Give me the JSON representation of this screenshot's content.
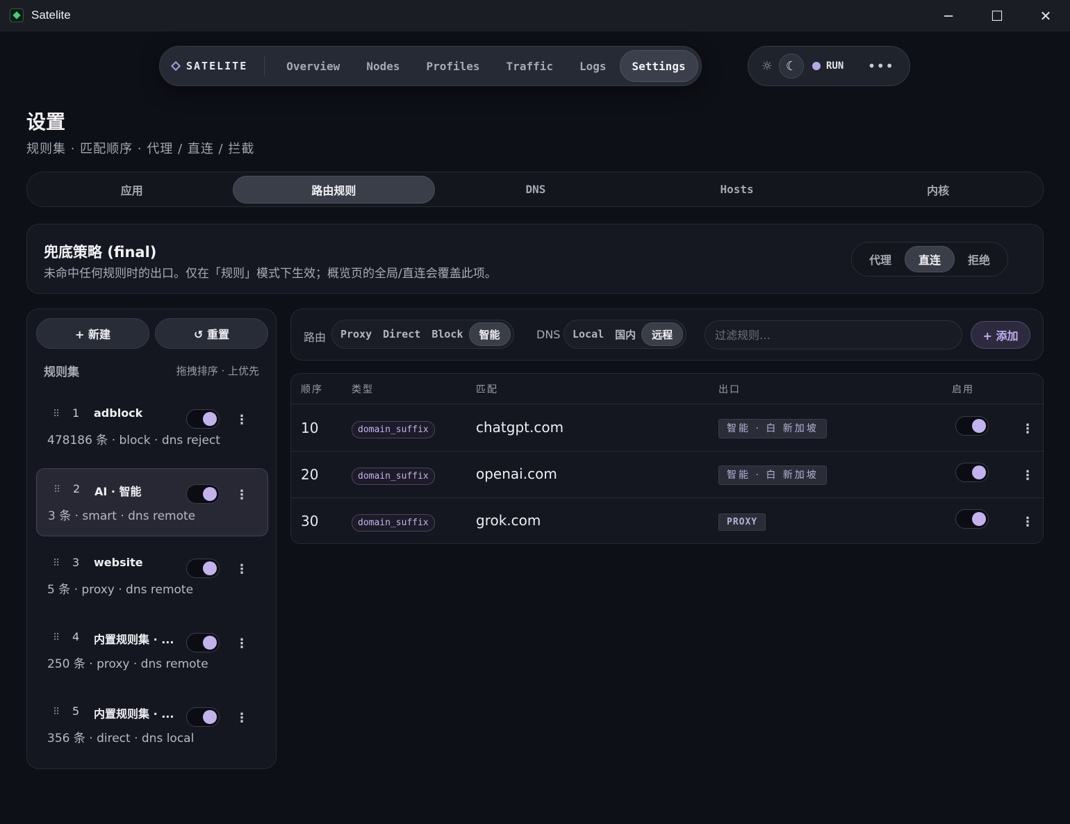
{
  "window": {
    "title": "Satelite",
    "minimize": "─",
    "maximize": "☐",
    "close": "✕"
  },
  "topnav": {
    "brand": "SATELITE",
    "items": [
      "Overview",
      "Nodes",
      "Profiles",
      "Traffic",
      "Logs",
      "Settings"
    ],
    "active": "Settings",
    "sun_icon": "☼",
    "moon_icon": "☾",
    "status": "RUN",
    "more": "•••"
  },
  "page": {
    "title": "设置",
    "subtitle": "规则集 · 匹配顺序 · 代理 / 直连 / 拦截"
  },
  "tabs": [
    "应用",
    "路由规则",
    "DNS",
    "Hosts",
    "内核"
  ],
  "final": {
    "title": "兜底策略 (final)",
    "desc": "未命中任何规则时的出口。仅在「规则」模式下生效；概览页的全局/直连会覆盖此项。",
    "options": [
      "代理",
      "直连",
      "拒绝"
    ],
    "selected": "直连"
  },
  "left": {
    "new_label": "+ 新建",
    "reset_label": "↺ 重置",
    "heading": "规则集",
    "hint": "拖拽排序 · 上优先",
    "grip": "⠿",
    "kebab": "⋮",
    "rulesets": [
      {
        "idx": "1",
        "name": "adblock",
        "meta": "478186 条 · block · dns reject",
        "enabled": true
      },
      {
        "idx": "2",
        "name": "AI · 智能",
        "meta": "3 条 · smart · dns remote",
        "enabled": true
      },
      {
        "idx": "3",
        "name": "website",
        "meta": "5 条 · proxy · dns remote",
        "enabled": true
      },
      {
        "idx": "4",
        "name": "内置规则集 · ...",
        "meta": "250 条 · proxy · dns remote",
        "enabled": true
      },
      {
        "idx": "5",
        "name": "内置规则集 · ...",
        "meta": "356 条 · direct · dns local",
        "enabled": true
      }
    ]
  },
  "filter": {
    "route_label": "路由",
    "route_options": [
      "Proxy",
      "Direct",
      "Block",
      "智能"
    ],
    "route_selected": "智能",
    "dns_label": "DNS",
    "dns_options": [
      "Local",
      "国内",
      "远程"
    ],
    "dns_selected": "远程",
    "search_placeholder": "过滤规则…",
    "add_label": "+ 添加"
  },
  "table": {
    "headers": [
      "顺序",
      "类型",
      "匹配",
      "出口",
      "启用"
    ],
    "rows": [
      {
        "order": "10",
        "type": "domain_suffix",
        "match": "chatgpt.com",
        "out": "智能 · 白 新加坡",
        "enabled": true
      },
      {
        "order": "20",
        "type": "domain_suffix",
        "match": "openai.com",
        "out": "智能 · 白 新加坡",
        "enabled": true
      },
      {
        "order": "30",
        "type": "domain_suffix",
        "match": "grok.com",
        "out": "PROXY",
        "enabled": true
      }
    ]
  },
  "colors": {
    "accent": "#c2b3ee",
    "bg": "#0e1017",
    "panel": "#141720"
  }
}
